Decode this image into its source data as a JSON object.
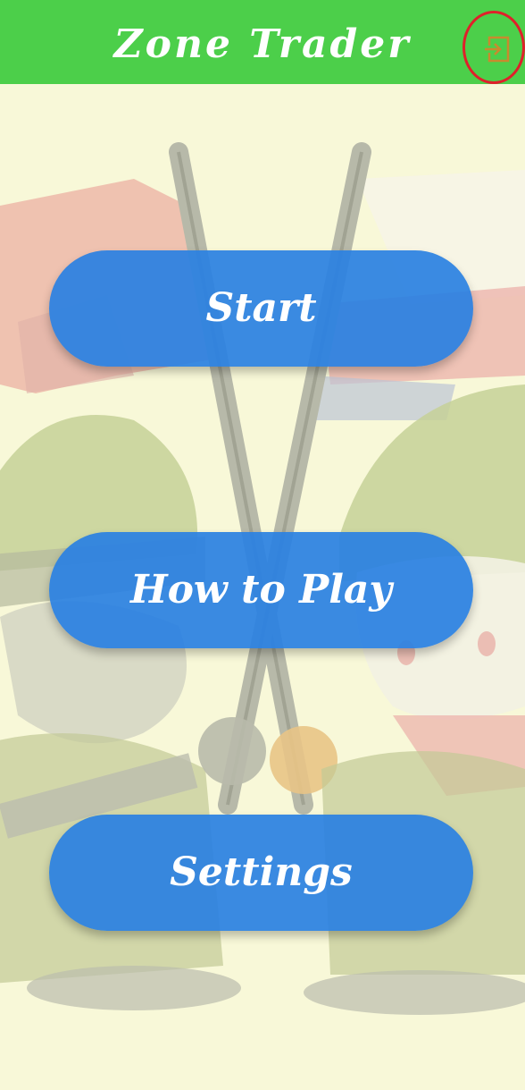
{
  "app": {
    "title": "Zone Trader"
  },
  "header": {
    "exit_icon": "exit-to-app-icon",
    "exit_highlight_color": "#e0202a"
  },
  "menu": {
    "start_label": "Start",
    "how_to_play_label": "How to Play",
    "settings_label": "Settings"
  },
  "theme": {
    "app_bar_color": "#4ccf4a",
    "button_color": "#2980e2",
    "background_color": "#f8f8d8"
  }
}
